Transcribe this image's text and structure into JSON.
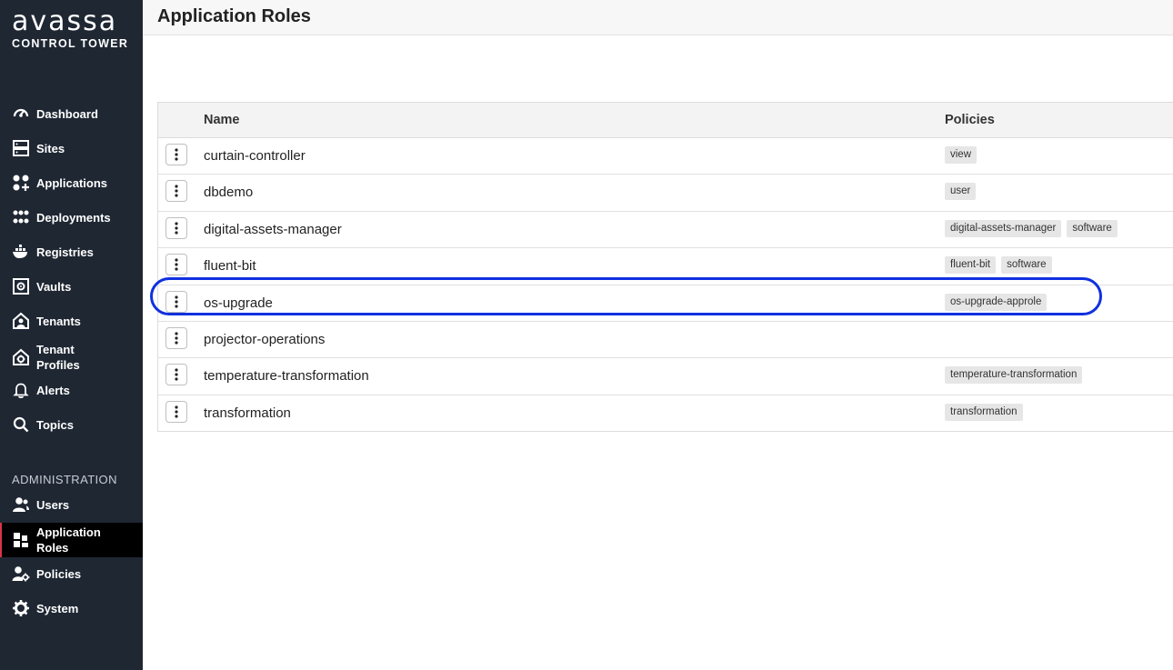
{
  "brand": {
    "word": "avassa",
    "subtitle": "CONTROL TOWER"
  },
  "sidebar": {
    "items": [
      {
        "label": "Dashboard",
        "icon": "dashboard-icon"
      },
      {
        "label": "Sites",
        "icon": "sites-icon"
      },
      {
        "label": "Applications",
        "icon": "applications-icon"
      },
      {
        "label": "Deployments",
        "icon": "deployments-icon"
      },
      {
        "label": "Registries",
        "icon": "registries-icon"
      },
      {
        "label": "Vaults",
        "icon": "vault-icon"
      },
      {
        "label": "Tenants",
        "icon": "tenants-icon"
      },
      {
        "label": "Tenant Profiles",
        "icon": "tenant-profiles-icon"
      },
      {
        "label": "Alerts",
        "icon": "bell-icon"
      },
      {
        "label": "Topics",
        "icon": "search-icon"
      }
    ],
    "admin_label": "ADMINISTRATION",
    "admin_items": [
      {
        "label": "Users",
        "icon": "users-icon"
      },
      {
        "label": "Application Roles",
        "icon": "application-roles-icon",
        "active": true
      },
      {
        "label": "Policies",
        "icon": "policies-icon"
      },
      {
        "label": "System",
        "icon": "gear-icon"
      }
    ]
  },
  "page": {
    "title": "Application Roles"
  },
  "table": {
    "columns": [
      "Name",
      "Policies"
    ],
    "rows": [
      {
        "name": "curtain-controller",
        "policies": [
          "view"
        ]
      },
      {
        "name": "dbdemo",
        "policies": [
          "user"
        ]
      },
      {
        "name": "digital-assets-manager",
        "policies": [
          "digital-assets-manager",
          "software"
        ]
      },
      {
        "name": "fluent-bit",
        "policies": [
          "fluent-bit",
          "software"
        ]
      },
      {
        "name": "os-upgrade",
        "policies": [
          "os-upgrade-approle"
        ],
        "highlighted": true
      },
      {
        "name": "projector-operations",
        "policies": []
      },
      {
        "name": "temperature-transformation",
        "policies": [
          "temperature-transformation"
        ]
      },
      {
        "name": "transformation",
        "policies": [
          "transformation"
        ]
      }
    ]
  },
  "colors": {
    "sidebar_bg": "#1f2733",
    "active_bg": "#000000",
    "active_accent": "#d9354a",
    "highlight": "#1030e0"
  }
}
